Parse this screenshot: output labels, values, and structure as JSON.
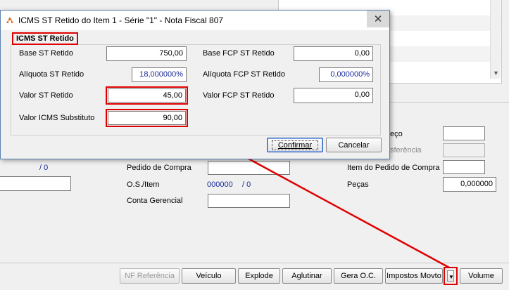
{
  "dialog": {
    "title": "ICMS ST Retido do Item 1 - Série \"1\" - Nota Fiscal 807",
    "close_glyph": "✕",
    "group_caption": "ICMS ST Retido",
    "fields": {
      "base_st_retido": {
        "label": "Base ST Retido",
        "value": "750,00"
      },
      "aliquota_st_retido": {
        "label": "Alíquota ST Retido",
        "value": "18,000000%"
      },
      "valor_st_retido": {
        "label": "Valor ST Retido",
        "value": "45,00"
      },
      "valor_icms_substituto": {
        "label": "Valor ICMS Substituto",
        "value": "90,00"
      },
      "base_fcp_st_retido": {
        "label": "Base FCP ST Retido",
        "value": "0,00"
      },
      "aliquota_fcp_st_retido": {
        "label": "Alíquota FCP ST Retido",
        "value": "0,000000%"
      },
      "valor_fcp_st_retido": {
        "label": "Valor FCP ST Retido",
        "value": "0,00"
      }
    },
    "buttons": {
      "confirm": "Confirmar",
      "cancel": "Cancelar"
    }
  },
  "background": {
    "slash_zero_left": "/ 0",
    "pedido_compra_label": "Pedido de Compra",
    "os_item_label": "O.S./Item",
    "os_item_number": "000000",
    "os_item_slash": "/ 0",
    "conta_gerencial_label": "Conta Gerencial",
    "preco_partial": "eço",
    "referencia_partial": "sferência",
    "item_pedido_compra_label": "Item do Pedido de Compra",
    "pecas_label": "Peças",
    "pecas_value": "0,000000"
  },
  "toolbar": {
    "nf_referencia": "NF Referência",
    "veiculo": "Veículo",
    "explode": "Explode",
    "aglutinar": "Aglutinar",
    "gera_oc": "Gera O.C.",
    "impostos_movto": "Impostos Movto",
    "volume": "Volume"
  },
  "colors": {
    "highlight": "#e00000",
    "value_blue": "#1a2a9a"
  }
}
